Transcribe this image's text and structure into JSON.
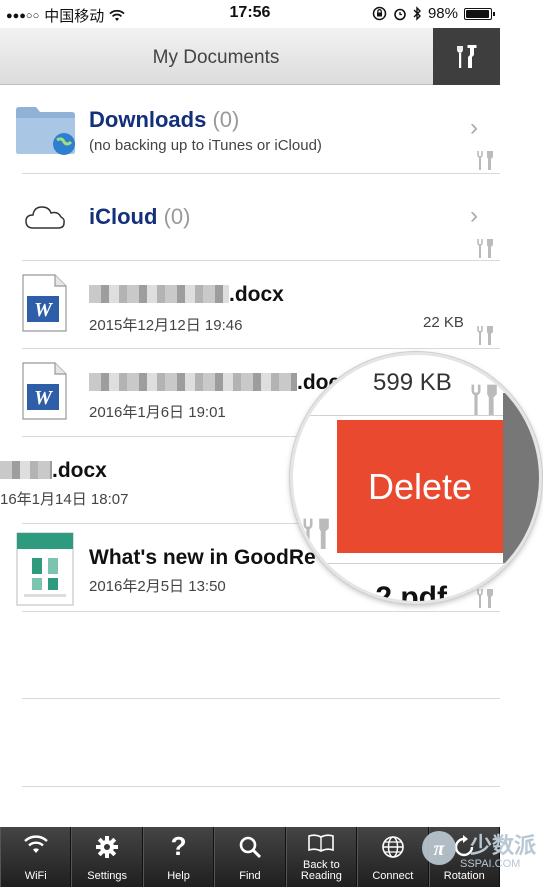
{
  "status_bar": {
    "carrier": "中国移动",
    "time": "17:56",
    "battery": "98%",
    "battery_level": 0.98
  },
  "navbar": {
    "title": "My Documents"
  },
  "folders": [
    {
      "name": "Downloads",
      "count": "(0)",
      "subtitle": "(no backing up to iTunes or iCloud)"
    },
    {
      "name": "iCloud",
      "count": "(0)"
    }
  ],
  "files": [
    {
      "name_suffix": ".docx",
      "date": "2015年12月12日 19:46",
      "size": "22 KB"
    },
    {
      "name_suffix": ".doc",
      "date": "2016年1月6日 19:01"
    },
    {
      "name_suffix": ".docx",
      "date": "16年1月14日 18:07"
    },
    {
      "name": "What's new in GoodRe",
      "date": "2016年2月5日 13:50"
    }
  ],
  "magnifier": {
    "size": "599 KB",
    "delete_label": "Delete",
    "pdf_fragment": ".2 pdf"
  },
  "toolbar": [
    {
      "label": "WiFi",
      "icon": "wifi-icon"
    },
    {
      "label": "Settings",
      "icon": "gear-icon"
    },
    {
      "label": "Help",
      "icon": "help-icon"
    },
    {
      "label": "Find",
      "icon": "search-icon"
    },
    {
      "label": "Back to Reading",
      "icon": "book-icon"
    },
    {
      "label": "Connect",
      "icon": "globe-icon"
    },
    {
      "label": "Rotation",
      "icon": "rotation-icon"
    }
  ],
  "watermark": {
    "text": "少数派",
    "sub": "SSPAI.COM"
  },
  "colors": {
    "link": "#13307a",
    "delete": "#e9492f",
    "toolbar": "#2f2f2f"
  }
}
